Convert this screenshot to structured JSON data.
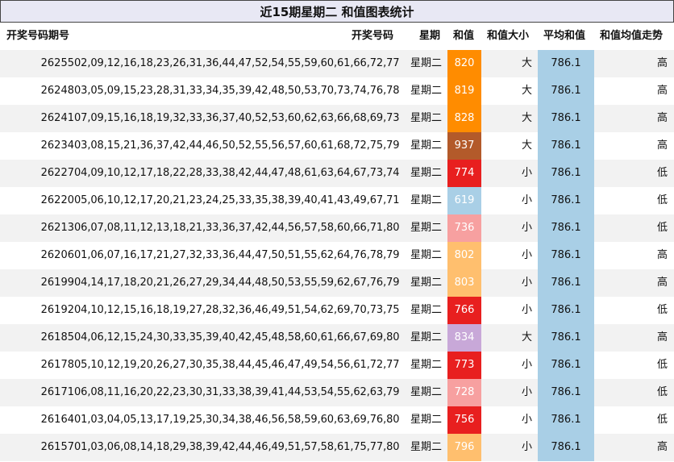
{
  "title": "近15期星期二 和值图表统计",
  "headers": {
    "issue": "开奖号码期号",
    "numbers": "开奖号码",
    "weekday": "星期",
    "sum": "和值",
    "size": "和值大小",
    "avg": "平均和值",
    "trend": "和值均值走势"
  },
  "colors": {
    "orange": "#ff8c00",
    "brown": "#b35a2a",
    "red": "#e81f1f",
    "lightblue": "#a9cfe6",
    "pink": "#f7a0a0",
    "lightorange": "#ffbf6e",
    "lavender": "#c8a8d8"
  },
  "rows": [
    {
      "issue": "26255",
      "numbers": "02,09,12,16,18,23,26,31,36,44,47,52,54,55,59,60,61,66,72,77",
      "weekday": "星期二",
      "sum": "820",
      "sum_color": "orange",
      "size": "大",
      "avg": "786.1",
      "trend": "高"
    },
    {
      "issue": "26248",
      "numbers": "03,05,09,15,23,28,31,33,34,35,39,42,48,50,53,70,73,74,76,78",
      "weekday": "星期二",
      "sum": "819",
      "sum_color": "orange",
      "size": "大",
      "avg": "786.1",
      "trend": "高"
    },
    {
      "issue": "26241",
      "numbers": "07,09,15,16,18,19,32,33,36,37,40,52,53,60,62,63,66,68,69,73",
      "weekday": "星期二",
      "sum": "828",
      "sum_color": "orange",
      "size": "大",
      "avg": "786.1",
      "trend": "高"
    },
    {
      "issue": "26234",
      "numbers": "03,08,15,21,36,37,42,44,46,50,52,55,56,57,60,61,68,72,75,79",
      "weekday": "星期二",
      "sum": "937",
      "sum_color": "brown",
      "size": "大",
      "avg": "786.1",
      "trend": "高"
    },
    {
      "issue": "26227",
      "numbers": "04,09,10,12,17,18,22,28,33,38,42,44,47,48,61,63,64,67,73,74",
      "weekday": "星期二",
      "sum": "774",
      "sum_color": "red",
      "size": "小",
      "avg": "786.1",
      "trend": "低"
    },
    {
      "issue": "26220",
      "numbers": "05,06,10,12,17,20,21,23,24,25,33,35,38,39,40,41,43,49,67,71",
      "weekday": "星期二",
      "sum": "619",
      "sum_color": "lightblue",
      "size": "小",
      "avg": "786.1",
      "trend": "低"
    },
    {
      "issue": "26213",
      "numbers": "06,07,08,11,12,13,18,21,33,36,37,42,44,56,57,58,60,66,71,80",
      "weekday": "星期二",
      "sum": "736",
      "sum_color": "pink",
      "size": "小",
      "avg": "786.1",
      "trend": "低"
    },
    {
      "issue": "26206",
      "numbers": "01,06,07,16,17,21,27,32,33,36,44,47,50,51,55,62,64,76,78,79",
      "weekday": "星期二",
      "sum": "802",
      "sum_color": "lightorange",
      "size": "小",
      "avg": "786.1",
      "trend": "高"
    },
    {
      "issue": "26199",
      "numbers": "04,14,17,18,20,21,26,27,29,34,44,48,50,53,55,59,62,67,76,79",
      "weekday": "星期二",
      "sum": "803",
      "sum_color": "lightorange",
      "size": "小",
      "avg": "786.1",
      "trend": "高"
    },
    {
      "issue": "26192",
      "numbers": "04,10,12,15,16,18,19,27,28,32,36,46,49,51,54,62,69,70,73,75",
      "weekday": "星期二",
      "sum": "766",
      "sum_color": "red",
      "size": "小",
      "avg": "786.1",
      "trend": "低"
    },
    {
      "issue": "26185",
      "numbers": "04,06,12,15,24,30,33,35,39,40,42,45,48,58,60,61,66,67,69,80",
      "weekday": "星期二",
      "sum": "834",
      "sum_color": "lavender",
      "size": "大",
      "avg": "786.1",
      "trend": "高"
    },
    {
      "issue": "26178",
      "numbers": "05,10,12,19,20,26,27,30,35,38,44,45,46,47,49,54,56,61,72,77",
      "weekday": "星期二",
      "sum": "773",
      "sum_color": "red",
      "size": "小",
      "avg": "786.1",
      "trend": "低"
    },
    {
      "issue": "26171",
      "numbers": "06,08,11,16,20,22,23,30,31,33,38,39,41,44,53,54,55,62,63,79",
      "weekday": "星期二",
      "sum": "728",
      "sum_color": "pink",
      "size": "小",
      "avg": "786.1",
      "trend": "低"
    },
    {
      "issue": "26164",
      "numbers": "01,03,04,05,13,17,19,25,30,34,38,46,56,58,59,60,63,69,76,80",
      "weekday": "星期二",
      "sum": "756",
      "sum_color": "red",
      "size": "小",
      "avg": "786.1",
      "trend": "低"
    },
    {
      "issue": "26157",
      "numbers": "01,03,06,08,14,18,29,38,39,42,44,46,49,51,57,58,61,75,77,80",
      "weekday": "星期二",
      "sum": "796",
      "sum_color": "lightorange",
      "size": "小",
      "avg": "786.1",
      "trend": "高"
    }
  ]
}
